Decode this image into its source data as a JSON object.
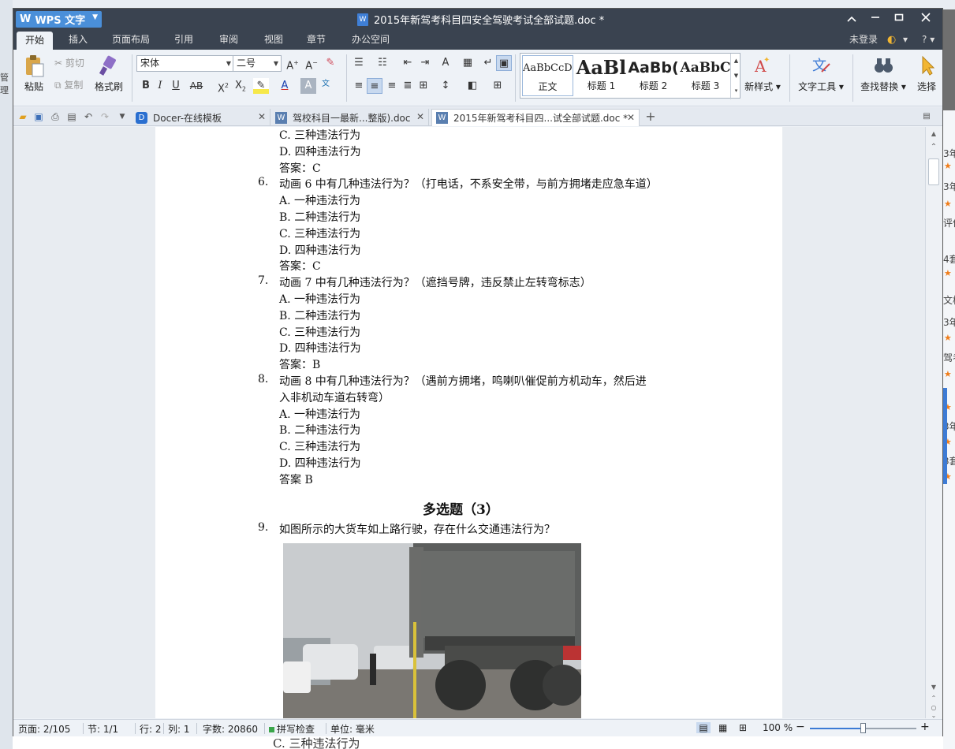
{
  "app": {
    "name": "WPS 文字",
    "document_title": "2015年新驾考科目四安全驾驶考试全部试题.doc *"
  },
  "menu": {
    "tabs": [
      "开始",
      "插入",
      "页面布局",
      "引用",
      "审阅",
      "视图",
      "章节",
      "办公空间"
    ],
    "active_tab": "开始",
    "login": "未登录",
    "help": "?"
  },
  "ribbon": {
    "paste": "粘贴",
    "cut": "剪切",
    "copy": "复制",
    "format_painter": "格式刷",
    "font_name": "宋体",
    "font_size": "二号",
    "styles": [
      {
        "sample": "AaBbCcDd",
        "name": "正文"
      },
      {
        "sample": "AaBl",
        "name": "标题 1"
      },
      {
        "sample": "AaBb(",
        "name": "标题 2"
      },
      {
        "sample": "AaBbC",
        "name": "标题 3"
      }
    ],
    "new_style": "新样式",
    "text_tools": "文字工具",
    "find_replace": "查找替换",
    "select": "选择"
  },
  "tabs": [
    {
      "label": "Docer-在线模板",
      "icon": "docer-icon",
      "active": false
    },
    {
      "label": "驾校科目一最新...整版).doc",
      "icon": "doc-icon",
      "active": false
    },
    {
      "label": "2015年新驾考科目四...试全部试题.doc *",
      "icon": "doc-icon",
      "active": true
    }
  ],
  "document": {
    "lines": [
      {
        "num": "",
        "text": "C.  三种违法行为",
        "indent": 1
      },
      {
        "num": "",
        "text": "D.  四种违法行为",
        "indent": 1
      },
      {
        "num": "",
        "text": "答案：C",
        "indent": 1
      },
      {
        "num": "6.",
        "text": "动画 6 中有几种违法行为？（打电话，不系安全带，与前方拥堵走应急车道）",
        "indent": 1
      },
      {
        "num": "",
        "text": "A.  一种违法行为",
        "indent": 1
      },
      {
        "num": "",
        "text": "B.  二种违法行为",
        "indent": 1
      },
      {
        "num": "",
        "text": "C.  三种违法行为",
        "indent": 1
      },
      {
        "num": "",
        "text": "D.  四种违法行为",
        "indent": 1
      },
      {
        "num": "",
        "text": "答案：C",
        "indent": 1
      },
      {
        "num": "7.",
        "text": "动画 7 中有几种违法行为？（遮挡号牌，违反禁止左转弯标志）",
        "indent": 1
      },
      {
        "num": "",
        "text": "A.  一种违法行为",
        "indent": 1
      },
      {
        "num": "",
        "text": "B.  二种违法行为",
        "indent": 1
      },
      {
        "num": "",
        "text": "C.  三种违法行为",
        "indent": 1
      },
      {
        "num": "",
        "text": "D.  四种违法行为",
        "indent": 1
      },
      {
        "num": "",
        "text": "答案：B",
        "indent": 1
      },
      {
        "num": "8.",
        "text": "动画 8 中有几种违法行为？（遇前方拥堵，鸣喇叭催促前方机动车，然后进",
        "indent": 1
      },
      {
        "num": "",
        "text": "入非机动车道右转弯）",
        "indent": 1
      },
      {
        "num": "",
        "text": "A.  一种违法行为",
        "indent": 1
      },
      {
        "num": "",
        "text": "B.  二种违法行为",
        "indent": 1
      },
      {
        "num": "",
        "text": "C.  三种违法行为",
        "indent": 1
      },
      {
        "num": "",
        "text": "D.  四种违法行为",
        "indent": 1
      },
      {
        "num": "",
        "text": "答案 B",
        "indent": 1
      }
    ],
    "heading": "多选题（3）",
    "q9_num": "9.",
    "q9_text": "如图所示的大货车如上路行驶，存在什么交通违法行为？"
  },
  "status": {
    "page": "页面: 2/105",
    "section": "节: 1/1",
    "row": "行: 2",
    "col": "列: 1",
    "words": "字数: 20860",
    "spell": "拼写检查",
    "unit": "单位: 毫米",
    "zoom": "100 %",
    "zoom_level": 0.5
  },
  "background": {
    "bottom_ghost": "C.   三种违法行为",
    "right_snippets": [
      "3年",
      "3年",
      "评价",
      "4套",
      "文档",
      "3年",
      "驾考",
      "3年",
      "3套"
    ],
    "left_snippets": [
      "管理"
    ]
  }
}
